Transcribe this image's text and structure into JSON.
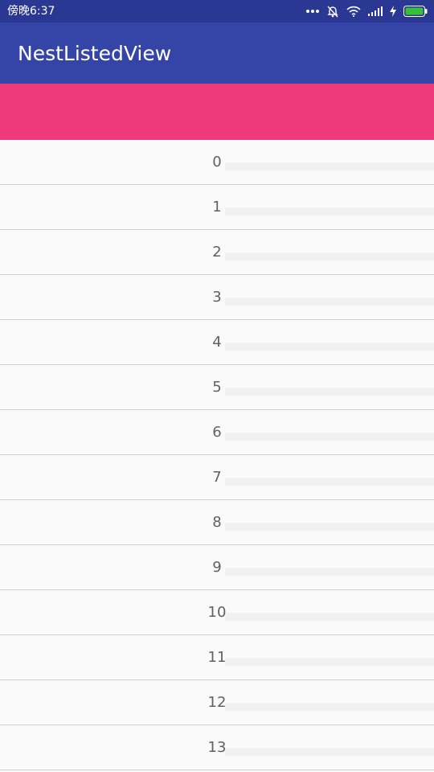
{
  "status_bar": {
    "time": "傍晚6:37",
    "icons": [
      "more-dots-icon",
      "notifications-off-icon",
      "wifi-icon",
      "signal-icon",
      "charging-bolt-icon",
      "battery-icon"
    ],
    "battery_color": "#39c03a"
  },
  "app_bar": {
    "title": "NestListedView",
    "color": "#3545a7"
  },
  "header": {
    "color": "#ee3a78"
  },
  "list": {
    "items": [
      "0",
      "1",
      "2",
      "3",
      "4",
      "5",
      "6",
      "7",
      "8",
      "9",
      "10",
      "11",
      "12",
      "13"
    ]
  }
}
